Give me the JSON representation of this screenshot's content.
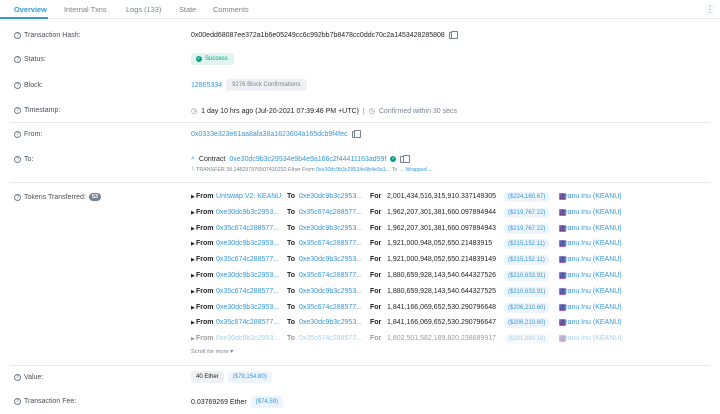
{
  "tabs": [
    {
      "label": "Overview",
      "active": true
    },
    {
      "label": "Internal Txns"
    },
    {
      "label": "Logs (133)"
    },
    {
      "label": "State"
    },
    {
      "label": "Comments"
    }
  ],
  "menu_icon": "⋮",
  "fields": {
    "tx_hash": {
      "label": "Transaction Hash:",
      "value": "0x00edd68087ee372a1b6e05249cc6c992bb7b8478cc0ddc70c2a1453428285808"
    },
    "status": {
      "label": "Status:",
      "value": "Success"
    },
    "block": {
      "label": "Block:",
      "value": "12865334",
      "confirmations": "9276 Block Confirmations"
    },
    "timestamp": {
      "label": "Timestamp:",
      "value": "1 day 10 hrs ago (Jul-20-2021 07:39:46 PM +UTC)",
      "separator": "|",
      "confirmed": "Confirmed within 30 secs"
    },
    "from": {
      "label": "From:",
      "value": "0x0333e323e61aa8afa38a1623604a165dcb9f4fec"
    },
    "to": {
      "label": "To:",
      "prefix": "Contract",
      "value": "0xe30dc9b3c29534e9b4e9a166c2f44411163ad59f",
      "transfer_prefix": "└ TRANSFER  38.148297976507430232 Ether From",
      "transfer_from": "0xe30dc9b3c29534e9b4e9a1...",
      "transfer_to_label": "To →",
      "transfer_to": "Wrapped ..."
    },
    "tokens": {
      "label": "Tokens Transferred:",
      "count": "53"
    },
    "value": {
      "label": "Value:",
      "amount": "40 Ether",
      "usd": "($79,154.80)"
    },
    "fee": {
      "label": "Transaction Fee:",
      "amount": "0.03769269 Ether",
      "usd": "($74.59)"
    }
  },
  "transfers": {
    "from_label": "From",
    "to_label": "To",
    "for_label": "For",
    "rows": [
      {
        "from": "Uniswap V2: KEANU",
        "to": "0xe30dc9b3c2953...",
        "amount": "2,001,434,516,315,910.337149305",
        "usd": "($224,160.67)",
        "token": "Keanu Inu (KEANU)"
      },
      {
        "from": "0xe30dc9b3c2953...",
        "to": "0x35c674c288577...",
        "amount": "1,962,207,301,381,660.097894944",
        "usd": "($219,767.22)",
        "token": "Keanu Inu (KEANU)"
      },
      {
        "from": "0x35c674c288577...",
        "to": "0xe30dc9b3c2953...",
        "amount": "1,962,207,301,381,660.097894943",
        "usd": "($219,767.22)",
        "token": "Keanu Inu (KEANU)"
      },
      {
        "from": "0xe30dc9b3c2953...",
        "to": "0x35c674c288577...",
        "amount": "1,921,000,948,052,650.21483915",
        "usd": "($215,152.11)",
        "token": "Keanu Inu (KEANU)"
      },
      {
        "from": "0x35c674c288577...",
        "to": "0xe30dc9b3c2953...",
        "amount": "1,921,000,948,052,650.214839149",
        "usd": "($215,152.11)",
        "token": "Keanu Inu (KEANU)"
      },
      {
        "from": "0xe30dc9b3c2953...",
        "to": "0x35c674c288577...",
        "amount": "1,880,659,928,143,540.644327526",
        "usd": "($210,633.91)",
        "token": "Keanu Inu (KEANU)"
      },
      {
        "from": "0x35c674c288577...",
        "to": "0xe30dc9b3c2953...",
        "amount": "1,880,659,928,143,540.644327525",
        "usd": "($210,633.91)",
        "token": "Keanu Inu (KEANU)"
      },
      {
        "from": "0xe30dc9b3c2953...",
        "to": "0x35c674c288577...",
        "amount": "1,841,166,069,652,530.290796648",
        "usd": "($206,210.60)",
        "token": "Keanu Inu (KEANU)"
      },
      {
        "from": "0x35c674c288577...",
        "to": "0xe30dc9b3c2953...",
        "amount": "1,841,166,069,652,530.290796647",
        "usd": "($206,210.60)",
        "token": "Keanu Inu (KEANU)"
      },
      {
        "from": "0xe30dc9b3c2953...",
        "to": "0x35c674c288577...",
        "amount": "1,802,501,582,189,820.238689917",
        "usd": "($201,880.18)",
        "token": "Keanu Inu (KEANU)"
      }
    ],
    "scroll_more": "Scroll for more ▾"
  },
  "colors": {
    "accent": "#3498db",
    "success": "#00a186",
    "text": "#1e2022",
    "muted": "#77838f"
  }
}
